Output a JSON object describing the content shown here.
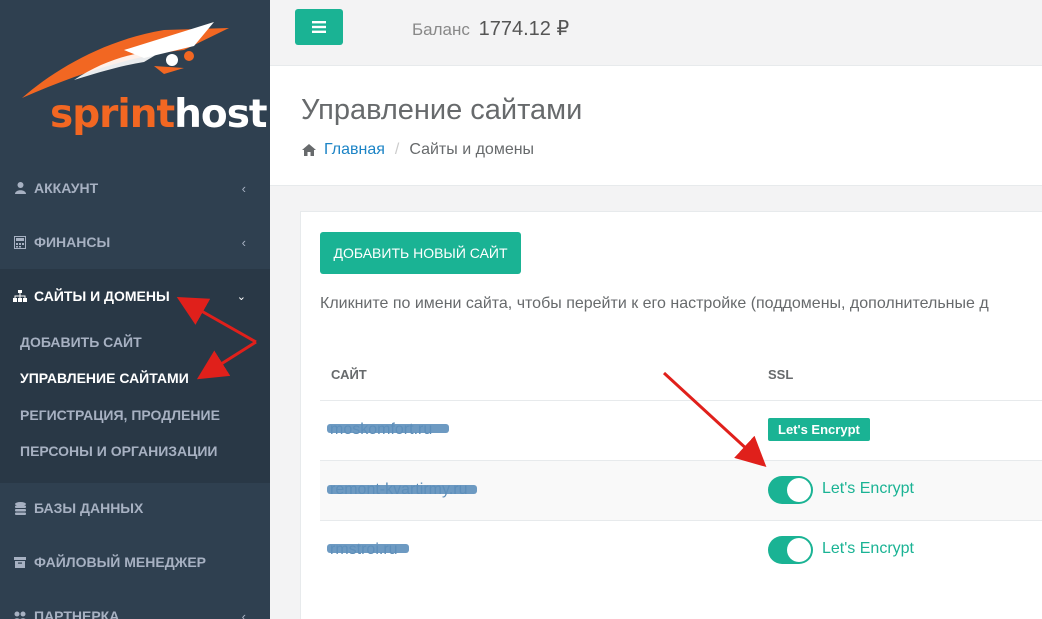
{
  "logo": {
    "part1": "sprint",
    "part2": "host"
  },
  "sidebar": {
    "items": [
      {
        "label": "Аккаунт",
        "icon": "user-icon"
      },
      {
        "label": "Финансы",
        "icon": "calculator-icon"
      },
      {
        "label": "Сайты и домены",
        "icon": "sitemap-icon"
      },
      {
        "label": "Базы данных",
        "icon": "database-icon"
      },
      {
        "label": "Файловый менеджер",
        "icon": "archive-icon"
      },
      {
        "label": "Партнерка",
        "icon": "users-icon"
      }
    ],
    "subitems": [
      {
        "label": "Добавить сайт"
      },
      {
        "label": "Управление сайтами"
      },
      {
        "label": "Регистрация, продление"
      },
      {
        "label": "Персоны и организации"
      }
    ]
  },
  "topbar": {
    "balance_label": "Баланс",
    "balance_value": "1774.12 ₽"
  },
  "page": {
    "title": "Управление сайтами",
    "breadcrumb": {
      "home": "Главная",
      "current": "Сайты и домены"
    }
  },
  "content": {
    "add_button": "Добавить новый сайт",
    "hint": "Кликните по имени сайта, чтобы перейти к его настройке (поддомены, дополнительные д",
    "table": {
      "headers": [
        "Сайт",
        "SSL"
      ],
      "rows": [
        {
          "site": "moskomfort.ru",
          "ssl": "Let's Encrypt"
        },
        {
          "site": "remont-kvartirmy.ru",
          "ssl": "Let's Encrypt"
        },
        {
          "site": "rmstroi.ru",
          "ssl": "Let's Encrypt"
        }
      ]
    }
  },
  "colors": {
    "accent": "#1ab394",
    "sidebar": "#2f4050",
    "logo_orange": "#f26722",
    "annotation": "#e0201b"
  }
}
